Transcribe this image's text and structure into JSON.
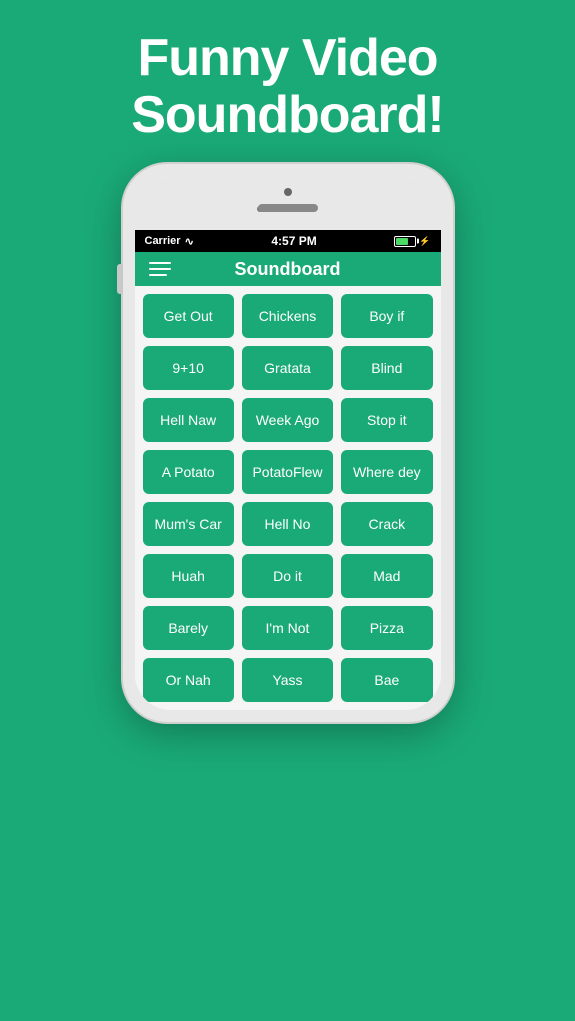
{
  "page": {
    "background_color": "#1aaa78",
    "title": "Funny Video\nSoundboard!",
    "title_color": "#ffffff"
  },
  "phone": {
    "status_bar": {
      "carrier": "Carrier",
      "wifi_symbol": "▾",
      "time": "4:57 PM",
      "battery_percent": "60"
    },
    "nav": {
      "title": "Soundboard",
      "menu_icon": "hamburger"
    },
    "sounds": [
      {
        "label": "Get Out"
      },
      {
        "label": "Chickens"
      },
      {
        "label": "Boy if"
      },
      {
        "label": "9+10"
      },
      {
        "label": "Gratata"
      },
      {
        "label": "Blind"
      },
      {
        "label": "Hell Naw"
      },
      {
        "label": "Week Ago"
      },
      {
        "label": "Stop it"
      },
      {
        "label": "A Potato"
      },
      {
        "label": "PotatoFlew"
      },
      {
        "label": "Where dey"
      },
      {
        "label": "Mum's Car"
      },
      {
        "label": "Hell No"
      },
      {
        "label": "Crack"
      },
      {
        "label": "Huah"
      },
      {
        "label": "Do it"
      },
      {
        "label": "Mad"
      },
      {
        "label": "Barely"
      },
      {
        "label": "I'm Not"
      },
      {
        "label": "Pizza"
      },
      {
        "label": "Or Nah"
      },
      {
        "label": "Yass"
      },
      {
        "label": "Bae"
      }
    ]
  }
}
